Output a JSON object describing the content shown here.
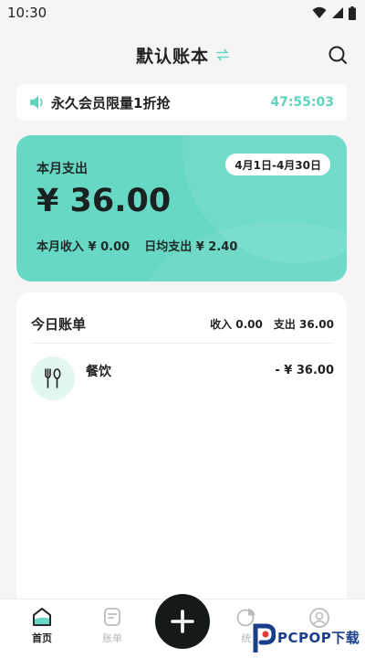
{
  "status_bar": {
    "time": "10:30"
  },
  "header": {
    "title": "默认账本"
  },
  "promo": {
    "text": "永久会员限量1折抢",
    "timer": "47:55:03"
  },
  "summary": {
    "label": "本月支出",
    "date_range": "4月1日-4月30日",
    "amount": "¥ 36.00",
    "income": "本月收入 ¥ 0.00",
    "daily_avg": "日均支出 ¥ 2.40"
  },
  "today": {
    "title": "今日账单",
    "income": "收入 0.00",
    "expense": "支出 36.00",
    "entries": [
      {
        "icon": "fork-spoon-icon",
        "category": "餐饮",
        "amount": "- ¥ 36.00"
      }
    ]
  },
  "bottom_nav": {
    "items": [
      {
        "label": "首页",
        "icon": "home-icon",
        "active": true
      },
      {
        "label": "账单",
        "icon": "bill-icon",
        "active": false
      },
      {
        "label": "统",
        "icon": "chart-icon",
        "active": false
      },
      {
        "label": "",
        "icon": "user-icon",
        "active": false
      }
    ]
  },
  "watermark": {
    "text": "PCPOP下载"
  },
  "colors": {
    "accent": "#67d8c3",
    "timer": "#5fd3bd",
    "fab": "#15191a"
  }
}
